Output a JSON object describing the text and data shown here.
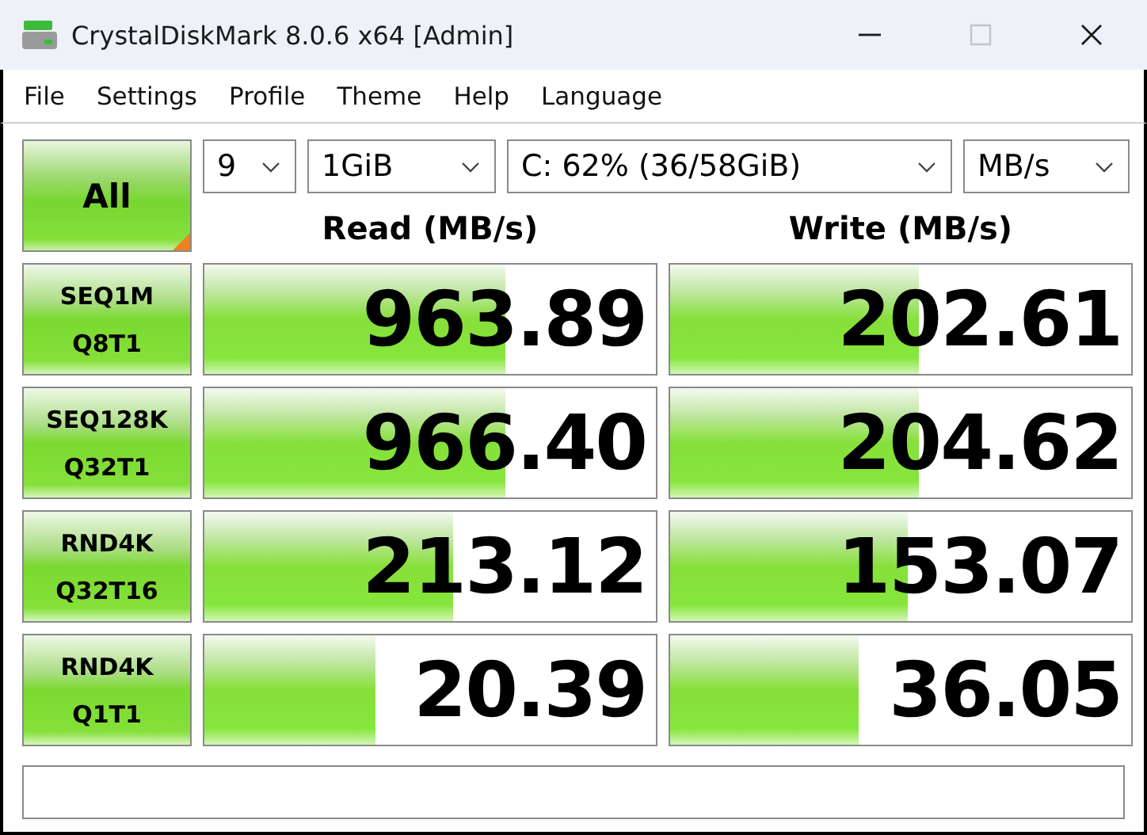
{
  "window": {
    "title": "CrystalDiskMark 8.0.6 x64 [Admin]",
    "controls": [
      {
        "kind": "minimize",
        "disabled": false
      },
      {
        "kind": "maximize",
        "disabled": true
      },
      {
        "kind": "close",
        "disabled": false
      }
    ]
  },
  "menu": [
    "File",
    "Settings",
    "Profile",
    "Theme",
    "Help",
    "Language"
  ],
  "all_button": {
    "label": "All"
  },
  "dropdowns": [
    {
      "kind": "count",
      "value": "9"
    },
    {
      "kind": "size",
      "value": "1GiB"
    },
    {
      "kind": "drive",
      "value": "C: 62% (36/58GiB)"
    },
    {
      "kind": "unit",
      "value": "MB/s"
    }
  ],
  "headers": [
    "Read (MB/s)",
    "Write (MB/s)"
  ],
  "rows": [
    {
      "label": [
        "SEQ1M",
        "Q8T1"
      ],
      "read": {
        "value": "963.89",
        "level": 0.665
      },
      "write": {
        "value": "202.61",
        "level": 0.54
      }
    },
    {
      "label": [
        "SEQ128K",
        "Q32T1"
      ],
      "read": {
        "value": "966.40",
        "level": 0.665
      },
      "write": {
        "value": "204.62",
        "level": 0.54
      }
    },
    {
      "label": [
        "RND4K",
        "Q32T16"
      ],
      "read": {
        "value": "213.12",
        "level": 0.55
      },
      "write": {
        "value": "153.07",
        "level": 0.515
      }
    },
    {
      "label": [
        "RND4K",
        "Q1T1"
      ],
      "read": {
        "value": "20.39",
        "level": 0.38
      },
      "write": {
        "value": "36.05",
        "level": 0.41
      }
    }
  ]
}
